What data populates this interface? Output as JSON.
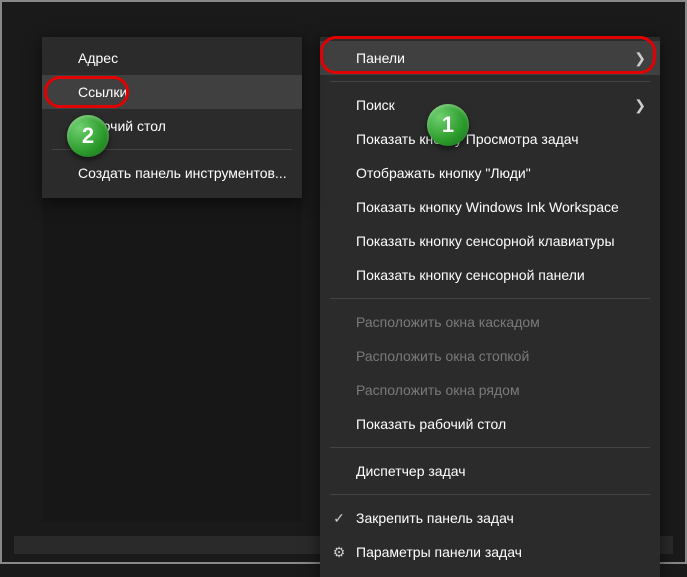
{
  "submenu": {
    "items": [
      {
        "label": "Адрес"
      },
      {
        "label": "Ссылки"
      },
      {
        "label": "Рабочий стол"
      },
      {
        "label": "Создать панель инструментов..."
      }
    ]
  },
  "mainmenu": {
    "items": [
      {
        "label": "Панели",
        "arrow": true
      },
      {
        "label": "Поиск",
        "arrow": true
      },
      {
        "label": "Показать кнопку Просмотра задач"
      },
      {
        "label": "Отображать кнопку \"Люди\""
      },
      {
        "label": "Показать кнопку Windows Ink Workspace"
      },
      {
        "label": "Показать кнопку сенсорной клавиатуры"
      },
      {
        "label": "Показать кнопку сенсорной панели"
      },
      {
        "sep": true
      },
      {
        "label": "Расположить окна каскадом",
        "disabled": true
      },
      {
        "label": "Расположить окна стопкой",
        "disabled": true
      },
      {
        "label": "Расположить окна рядом",
        "disabled": true
      },
      {
        "label": "Показать рабочий стол"
      },
      {
        "sep": true
      },
      {
        "label": "Диспетчер задач"
      },
      {
        "sep": true
      },
      {
        "label": "Закрепить панель задач",
        "icon": "check"
      },
      {
        "label": "Параметры панели задач",
        "icon": "gear"
      }
    ]
  },
  "badges": {
    "one": "1",
    "two": "2"
  }
}
